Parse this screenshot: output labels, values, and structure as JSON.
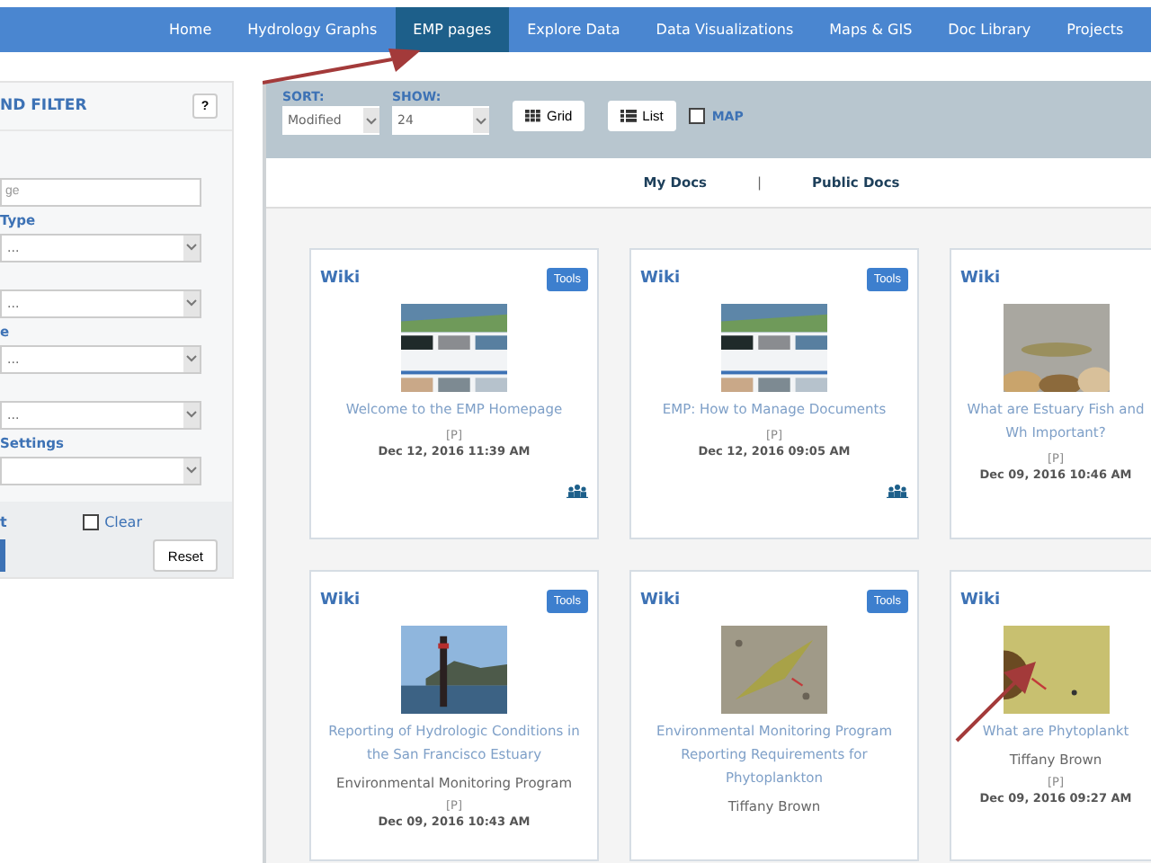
{
  "nav": [
    {
      "label": "Home",
      "selected": false
    },
    {
      "label": "Hydrology Graphs",
      "selected": false
    },
    {
      "label": "EMP pages",
      "selected": true
    },
    {
      "label": "Explore Data",
      "selected": false
    },
    {
      "label": "Data Visualizations",
      "selected": false
    },
    {
      "label": "Maps & GIS",
      "selected": false
    },
    {
      "label": "Doc Library",
      "selected": false
    },
    {
      "label": "Projects",
      "selected": false
    }
  ],
  "sidebar": {
    "title": "ND FILTER",
    "help": "?",
    "search": {
      "placeholder": "ge"
    },
    "filters": [
      {
        "label": "Type",
        "value": "..."
      },
      {
        "value": "..."
      },
      {
        "label": "e",
        "value": "..."
      },
      {
        "value": "..."
      },
      {
        "label": "Settings"
      }
    ],
    "footer_label": "t",
    "clear": {
      "label": "Clear",
      "checked": false
    },
    "reset": "Reset"
  },
  "toolbar": {
    "sort": {
      "label": "SORT:",
      "value": "Modified"
    },
    "show": {
      "label": "SHOW:",
      "value": "24"
    },
    "grid": "Grid",
    "list": "List",
    "map": {
      "label": "MAP",
      "checked": false
    }
  },
  "doc_tabs": [
    {
      "label": "My Docs"
    },
    {
      "label": "Public Docs"
    }
  ],
  "separator": "|",
  "cards": [
    {
      "type": "Wiki",
      "tools": "Tools",
      "title": "Welcome to the EMP Homepage",
      "flag": "[P]",
      "date": "Dec 12, 2016 11:39 AM",
      "shared": true
    },
    {
      "type": "Wiki",
      "tools": "Tools",
      "title": "EMP: How to Manage Documents",
      "flag": "[P]",
      "date": "Dec 12, 2016 09:05 AM",
      "shared": true
    },
    {
      "type": "Wiki",
      "title": "What are Estuary Fish and Wh Important?",
      "flag": "[P]",
      "date": "Dec 09, 2016 10:46 AM",
      "shared": false
    },
    {
      "type": "Wiki",
      "tools": "Tools",
      "title": "Reporting of Hydrologic Conditions in the San Francisco Estuary",
      "author": "Environmental Monitoring Program",
      "flag": "[P]",
      "date": "Dec 09, 2016 10:43 AM",
      "shared": false
    },
    {
      "type": "Wiki",
      "tools": "Tools",
      "title": "Environmental Monitoring Program Reporting Requirements for Phytoplankton",
      "author": "Tiffany Brown",
      "shared": false
    },
    {
      "type": "Wiki",
      "title": "What are Phytoplankt",
      "author": "Tiffany Brown",
      "flag": "[P]",
      "date": "Dec 09, 2016 09:27 AM",
      "shared": false
    }
  ]
}
